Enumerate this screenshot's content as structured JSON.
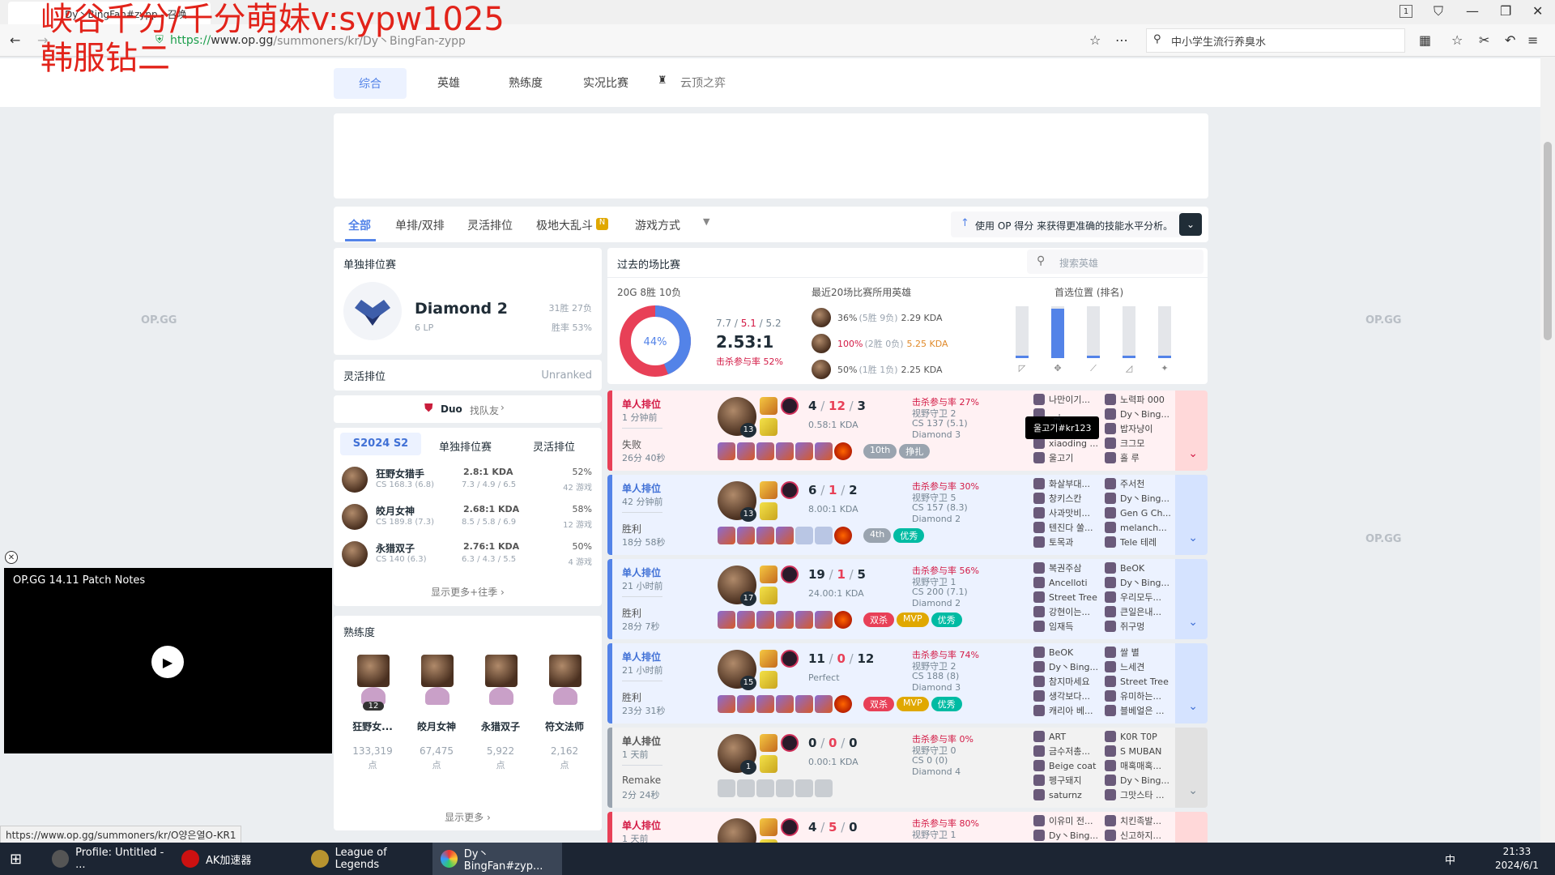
{
  "browser": {
    "tab_title": "Dy丶BingFan#zypp - 召唤",
    "url_prefix": "https://",
    "url_host": "www.op.gg",
    "url_path": "/summoners/kr/Dy丶BingFan-zypp",
    "search_text": "中小学生流行养臭水"
  },
  "watermark": {
    "line1": "峡谷千分/千分萌妹v:sypw1025",
    "line2": "韩服钻二"
  },
  "top_tabs": [
    "综合",
    "英雄",
    "熟练度",
    "实况比赛",
    "云顶之弈"
  ],
  "opgg_label": "OP.GG",
  "filters": {
    "tabs": [
      "全部",
      "单排/双排",
      "灵活排位",
      "极地大乱斗",
      "游戏方式"
    ],
    "new_badge": "N",
    "op_score_text": "使用 OP 得分 来获得更准确的技能水平分析。"
  },
  "solo": {
    "header": "单独排位赛",
    "tier": "Diamond 2",
    "lp": "6 LP",
    "record": "31胜 27负",
    "winrate": "胜率 53%"
  },
  "flex": {
    "header": "灵活排位",
    "status": "Unranked"
  },
  "duo": {
    "label": "Duo",
    "find": "找队友"
  },
  "season": {
    "tabs": [
      "S2024 S2",
      "单独排位赛",
      "灵活排位"
    ],
    "champs": [
      {
        "name": "狂野女猎手",
        "cs": "CS 168.3 (6.8)",
        "kda": "2.8:1 KDA",
        "kdastat": "7.3 / 4.9 / 6.5",
        "wr": "52%",
        "games": "42 游戏"
      },
      {
        "name": "皎月女神",
        "cs": "CS 189.8 (7.3)",
        "kda": "2.68:1 KDA",
        "kdastat": "8.5 / 5.8 / 6.9",
        "wr": "58%",
        "games": "12 游戏"
      },
      {
        "name": "永猎双子",
        "cs": "CS 140 (6.3)",
        "kda": "2.76:1 KDA",
        "kdastat": "6.3 / 4.3 / 5.5",
        "wr": "50%",
        "games": "4 游戏"
      }
    ],
    "more": "显示更多+往季"
  },
  "mastery": {
    "header": "熟练度",
    "items": [
      {
        "name": "狂野女...",
        "level": "12",
        "points": "133,319",
        "unit": "点"
      },
      {
        "name": "皎月女神",
        "level": "",
        "points": "67,475",
        "unit": "点"
      },
      {
        "name": "永猎双子",
        "level": "",
        "points": "5,922",
        "unit": "点"
      },
      {
        "name": "符文法师",
        "level": "",
        "points": "2,162",
        "unit": "点"
      }
    ],
    "more": "显示更多"
  },
  "video": {
    "title": "OP.GG 14.11 Patch Notes"
  },
  "recent": {
    "header": "过去的场比赛",
    "search_placeholder": "搜索英雄",
    "summary": "20G 8胜 10负",
    "winrate": "44%",
    "kda_line_k": "7.7",
    "kda_line_d": "5.1",
    "kda_line_a": "5.2",
    "kda_ratio": "2.53:1",
    "kp": "击杀参与率 52%",
    "champs_header": "最近20场比赛所用英雄",
    "champs": [
      {
        "wr": "36%",
        "rec": "(5胜 9负)",
        "kda": "2.29 KDA"
      },
      {
        "wr": "100%",
        "rec": "(2胜 0负)",
        "kda": "5.25 KDA"
      },
      {
        "wr": "50%",
        "rec": "(1胜 1负)",
        "kda": "2.25 KDA"
      }
    ],
    "pos_header": "首选位置 (排名)",
    "positions": [
      0.05,
      0.95,
      0.05,
      0.05,
      0.05
    ]
  },
  "matches": [
    {
      "result": "loss",
      "type": "单人排位",
      "ago": "1 分钟前",
      "outcome": "失败",
      "dur": "26分 40秒",
      "lvl": "13",
      "k": "4",
      "d": "12",
      "a": "3",
      "kda": "0.58:1 KDA",
      "kp": "击杀参与率 27%",
      "ward": "视野守卫 2",
      "cs": "CS 137 (5.1)",
      "rank": "Diamond 3",
      "tags": [
        "10th",
        "挣扎"
      ],
      "team1": [
        "나만이기...",
        "",
        "",
        "xiaoding ...",
        "울고기"
      ],
      "team2": [
        "노력파 000",
        "Dy丶Bing...",
        "밥자냥이",
        "크그모",
        "홀 루"
      ]
    },
    {
      "result": "win",
      "type": "单人排位",
      "ago": "42 分钟前",
      "outcome": "胜利",
      "dur": "18分 58秒",
      "lvl": "13",
      "k": "6",
      "d": "1",
      "a": "2",
      "kda": "8.00:1 KDA",
      "kp": "击杀参与率 30%",
      "ward": "视野守卫 5",
      "cs": "CS 157 (8.3)",
      "rank": "Diamond 2",
      "tags": [
        "4th",
        "优秀"
      ],
      "team1": [
        "화살부대...",
        "창키스칸",
        "사과맛비...",
        "텐진다 쑬...",
        "토목과"
      ],
      "team2": [
        "주서천",
        "Dy丶Bing...",
        "Gen G Ch...",
        "melanch...",
        "Tele 테레"
      ]
    },
    {
      "result": "win",
      "type": "单人排位",
      "ago": "21 小时前",
      "outcome": "胜利",
      "dur": "28分 7秒",
      "lvl": "17",
      "k": "19",
      "d": "1",
      "a": "5",
      "kda": "24.00:1 KDA",
      "kp": "击杀参与率 56%",
      "ward": "视野守卫 1",
      "cs": "CS 200 (7.1)",
      "rank": "Diamond 2",
      "tags": [
        "双杀",
        "MVP",
        "优秀"
      ],
      "team1": [
        "복권주삼",
        "Ancelloti",
        "Street Tree",
        "강현이는...",
        "임재득"
      ],
      "team2": [
        "BeOK",
        "Dy丶Bing...",
        "우리모두...",
        "큰일은내...",
        "쥐구멍"
      ]
    },
    {
      "result": "win",
      "type": "单人排位",
      "ago": "21 小时前",
      "outcome": "胜利",
      "dur": "23分 31秒",
      "lvl": "15",
      "k": "11",
      "d": "0",
      "a": "12",
      "kda": "Perfect",
      "kp": "击杀参与率 74%",
      "ward": "视野守卫 2",
      "cs": "CS 188 (8)",
      "rank": "Diamond 3",
      "tags": [
        "双杀",
        "MVP",
        "优秀"
      ],
      "team1": [
        "BeOK",
        "Dy丶Bing...",
        "참지마세요",
        "생각보다...",
        "캐리아 베..."
      ],
      "team2": [
        "쌀 별",
        "느세견",
        "Street Tree",
        "유미하는...",
        "블베얼은 ..."
      ]
    },
    {
      "result": "remake",
      "type": "单人排位",
      "ago": "1 天前",
      "outcome": "Remake",
      "dur": "2分 24秒",
      "lvl": "1",
      "k": "0",
      "d": "0",
      "a": "0",
      "kda": "0.00:1 KDA",
      "kp": "击杀参与率 0%",
      "ward": "视野守卫 0",
      "cs": "CS 0 (0)",
      "rank": "Diamond 4",
      "tags": [],
      "team1": [
        "ART",
        "금수저총...",
        "Beige coat",
        "펭구돼지",
        "saturnz"
      ],
      "team2": [
        "K0R T0P",
        "S MUBAN",
        "매혹매혹...",
        "Dy丶Bing...",
        "그맛스타 ..."
      ]
    },
    {
      "result": "loss",
      "type": "单人排位",
      "ago": "1 天前",
      "outcome": "",
      "dur": "",
      "lvl": "",
      "k": "4",
      "d": "5",
      "a": "0",
      "kda": "",
      "kp": "击杀参与率 80%",
      "ward": "视野守卫 1",
      "cs": "",
      "rank": "",
      "tags": [],
      "team1": [
        "이유미 전...",
        "Dy丶Bing..."
      ],
      "team2": [
        "치킨족발...",
        "신고하지..."
      ]
    }
  ],
  "tooltip": "울고기#kr123",
  "status_url": "https://www.op.gg/summoners/kr/O양은열O-KR1",
  "taskbar": {
    "items": [
      "Profile: Untitled - ...",
      "AK加速器",
      "League of Legends",
      "Dy丶BingFan#zyp..."
    ],
    "time": "21:33",
    "date": "2024/6/1",
    "ime": "中"
  }
}
